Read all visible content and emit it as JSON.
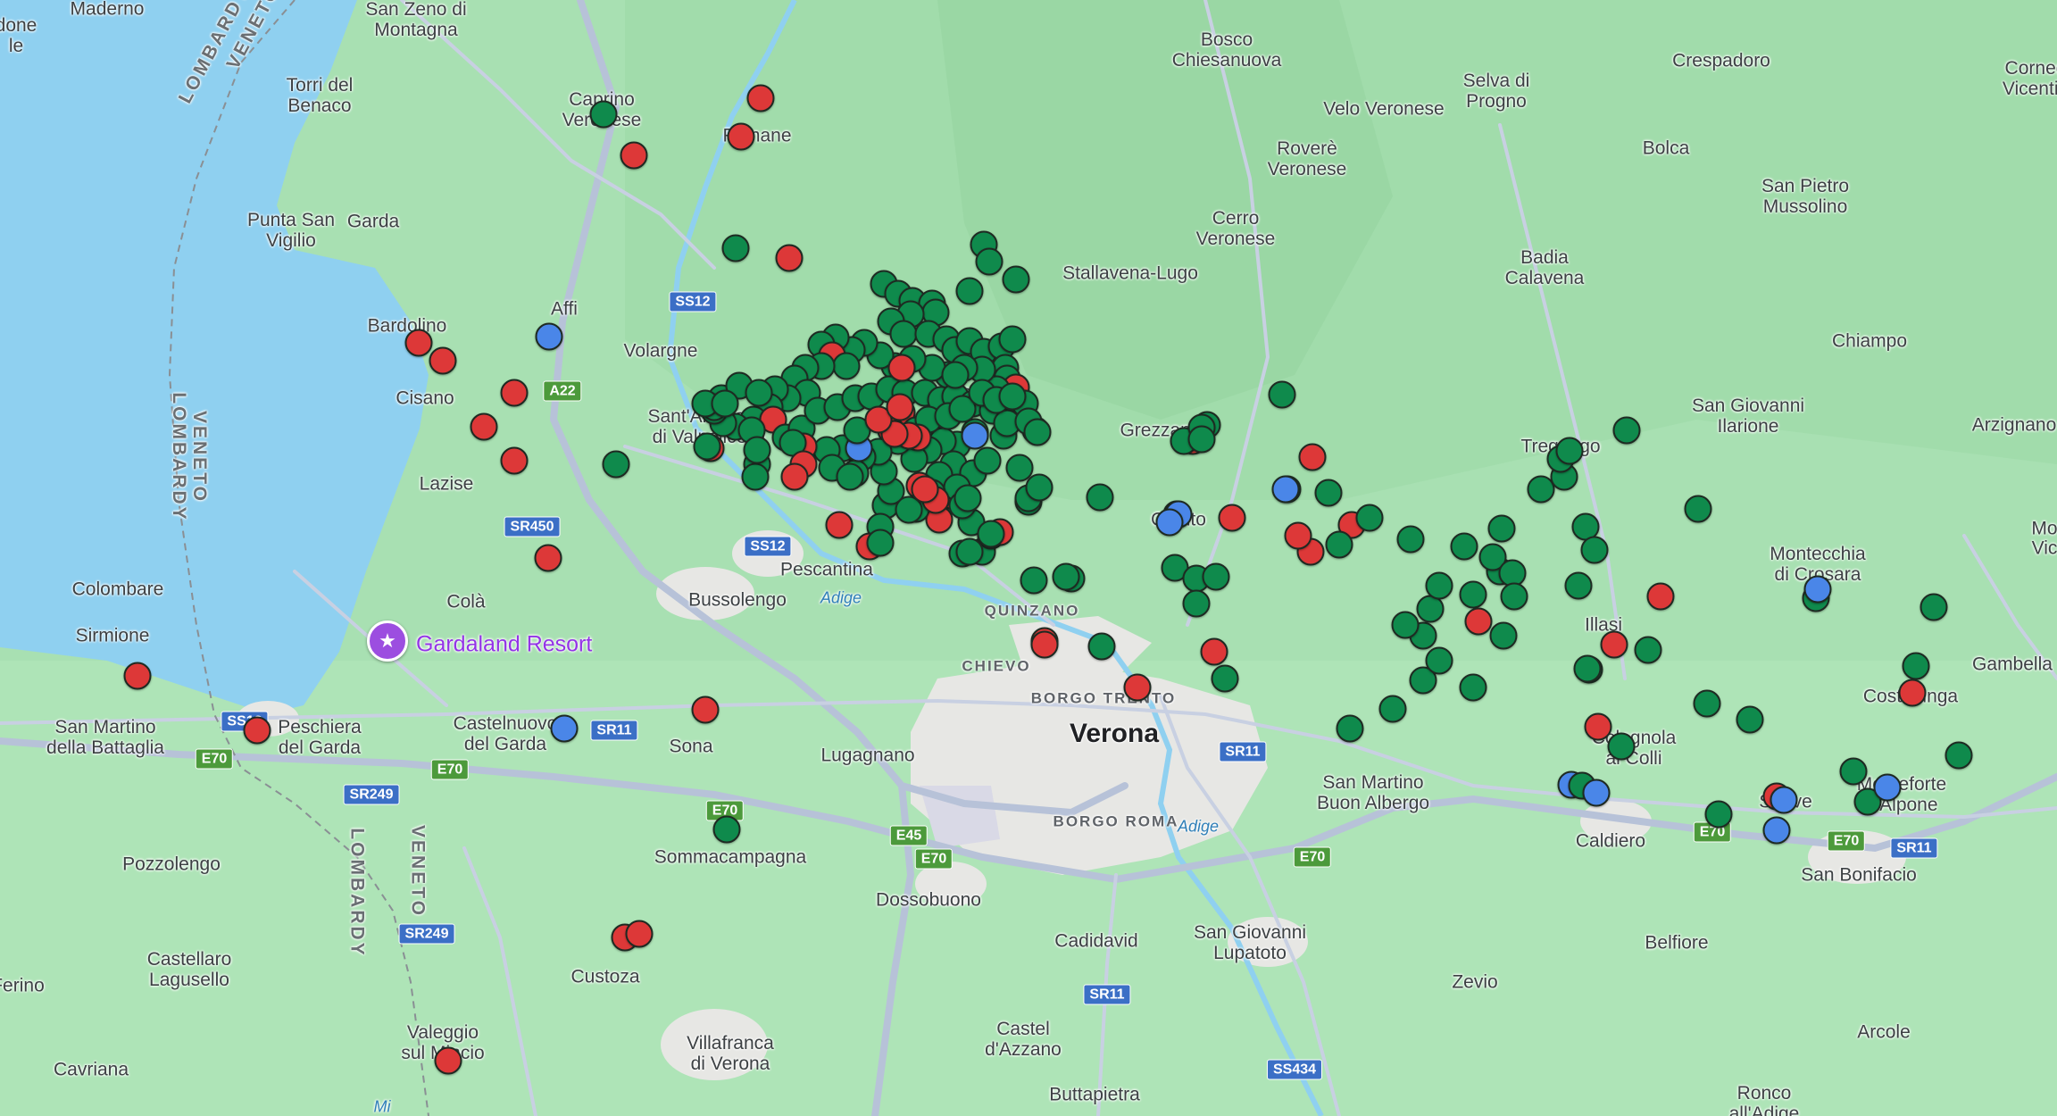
{
  "map": {
    "type": "markers-map",
    "colors": {
      "land": "#a8e0b2",
      "water": "#8fd0f0",
      "urban": "#e7e7e4",
      "road": "#b7c2d8",
      "green_marker": "#0f8a4c",
      "red_marker": "#dd3838",
      "blue_marker": "#4a86e8"
    },
    "poi": {
      "name": "Gardaland Resort",
      "icon": "amusement-park-icon"
    },
    "places": [
      {
        "text": "Maderno"
      },
      {
        "text": "done\nle"
      },
      {
        "text": "San Zeno di\nMontagna"
      },
      {
        "text": "Torri del\nBenaco"
      },
      {
        "text": "Caprino\nVeronese"
      },
      {
        "text": "Fumane"
      },
      {
        "text": "Punta San\nVigilio"
      },
      {
        "text": "Garda"
      },
      {
        "text": "Bardolino"
      },
      {
        "text": "Affi"
      },
      {
        "text": "Volargne"
      },
      {
        "text": "Cisano"
      },
      {
        "text": "Sant'Ambrogio\ndi Valpolicella"
      },
      {
        "text": "Negrar di\nValpolicella"
      },
      {
        "text": "Lazise"
      },
      {
        "text": "Pescantina"
      },
      {
        "text": "Bussolengo"
      },
      {
        "text": "Colombare"
      },
      {
        "text": "Colà"
      },
      {
        "text": "Sirmione"
      },
      {
        "text": "San Martino\ndella Battaglia"
      },
      {
        "text": "Peschiera\ndel Garda"
      },
      {
        "text": "Castelnuovo\ndel Garda"
      },
      {
        "text": "Sona"
      },
      {
        "text": "Lugagnano"
      },
      {
        "text": "Sommacampagna"
      },
      {
        "text": "Dossobuono"
      },
      {
        "text": "Pozzolengo"
      },
      {
        "text": "Castellaro\nLagusello"
      },
      {
        "text": "Custoza"
      },
      {
        "text": "Valeggio\nsul Mincio"
      },
      {
        "text": "Cavriana"
      },
      {
        "text": "Ferino"
      },
      {
        "text": "Villafranca\ndi Verona"
      },
      {
        "text": "Bosco\nChiesanuova"
      },
      {
        "text": "Velo Veronese"
      },
      {
        "text": "Selva di\nProgno"
      },
      {
        "text": "Crespadoro"
      },
      {
        "text": "Corned\nVicentin"
      },
      {
        "text": "Roverè\nVeronese"
      },
      {
        "text": "Bolca"
      },
      {
        "text": "San Pietro\nMussolino"
      },
      {
        "text": "Cerro\nVeronese"
      },
      {
        "text": "Badia\nCalavena"
      },
      {
        "text": "Stallavena-Lugo"
      },
      {
        "text": "Chiampo"
      },
      {
        "text": "Grezzana"
      },
      {
        "text": "San Giovanni\nIlarione"
      },
      {
        "text": "Arzignano"
      },
      {
        "text": "Tregnago"
      },
      {
        "text": "Quinto"
      },
      {
        "text": "Montecchia\ndi Crosara"
      },
      {
        "text": "Illasi"
      },
      {
        "text": "Gambella"
      },
      {
        "text": "Costalunga"
      },
      {
        "text": "Colognola\nai Colli"
      },
      {
        "text": "San Martino\nBuon Albergo"
      },
      {
        "text": "Soave"
      },
      {
        "text": "Monteforte\nd'Alpone"
      },
      {
        "text": "Caldiero"
      },
      {
        "text": "San Bonifacio"
      },
      {
        "text": "Belfiore"
      },
      {
        "text": "Zevio"
      },
      {
        "text": "Arcole"
      },
      {
        "text": "Cadidavid"
      },
      {
        "text": "San Giovanni\nLupatoto"
      },
      {
        "text": "Castel\nd'Azzano"
      },
      {
        "text": "Buttapietra"
      },
      {
        "text": "Ronco\nall'Adige"
      },
      {
        "text": "Mo"
      },
      {
        "text": "Vic"
      },
      {
        "text": "Verona"
      },
      {
        "text": "QUINZANO"
      },
      {
        "text": "CHIEVO"
      },
      {
        "text": "BORGO TRENTO"
      },
      {
        "text": "BORGO ROMA"
      },
      {
        "text": "Adige"
      },
      {
        "text": "Adige"
      },
      {
        "text": "Mi"
      },
      {
        "text": "VENETO\nLOMBARDY"
      },
      {
        "text": "LOMBARDY"
      },
      {
        "text": "VENETO"
      },
      {
        "text": "LOMBARDY"
      },
      {
        "text": "VENETO"
      }
    ],
    "shields": [
      {
        "text": "SS12",
        "color": "blue"
      },
      {
        "text": "A22",
        "color": "green"
      },
      {
        "text": "SR450",
        "color": "blue"
      },
      {
        "text": "SS12",
        "color": "blue"
      },
      {
        "text": "SR11",
        "color": "blue"
      },
      {
        "text": "SR11",
        "color": "blue"
      },
      {
        "text": "E70",
        "color": "green"
      },
      {
        "text": "E70",
        "color": "green"
      },
      {
        "text": "SR249",
        "color": "blue"
      },
      {
        "text": "E70",
        "color": "green"
      },
      {
        "text": "E45",
        "color": "green"
      },
      {
        "text": "E70",
        "color": "green"
      },
      {
        "text": "SR249",
        "color": "blue"
      },
      {
        "text": "SR11",
        "color": "blue"
      },
      {
        "text": "E70",
        "color": "green"
      },
      {
        "text": "SS12",
        "color": "blue"
      },
      {
        "text": "SS434",
        "color": "blue"
      },
      {
        "text": "E70",
        "color": "green"
      },
      {
        "text": "E70",
        "color": "green"
      },
      {
        "text": "SR11",
        "color": "blue"
      }
    ]
  }
}
